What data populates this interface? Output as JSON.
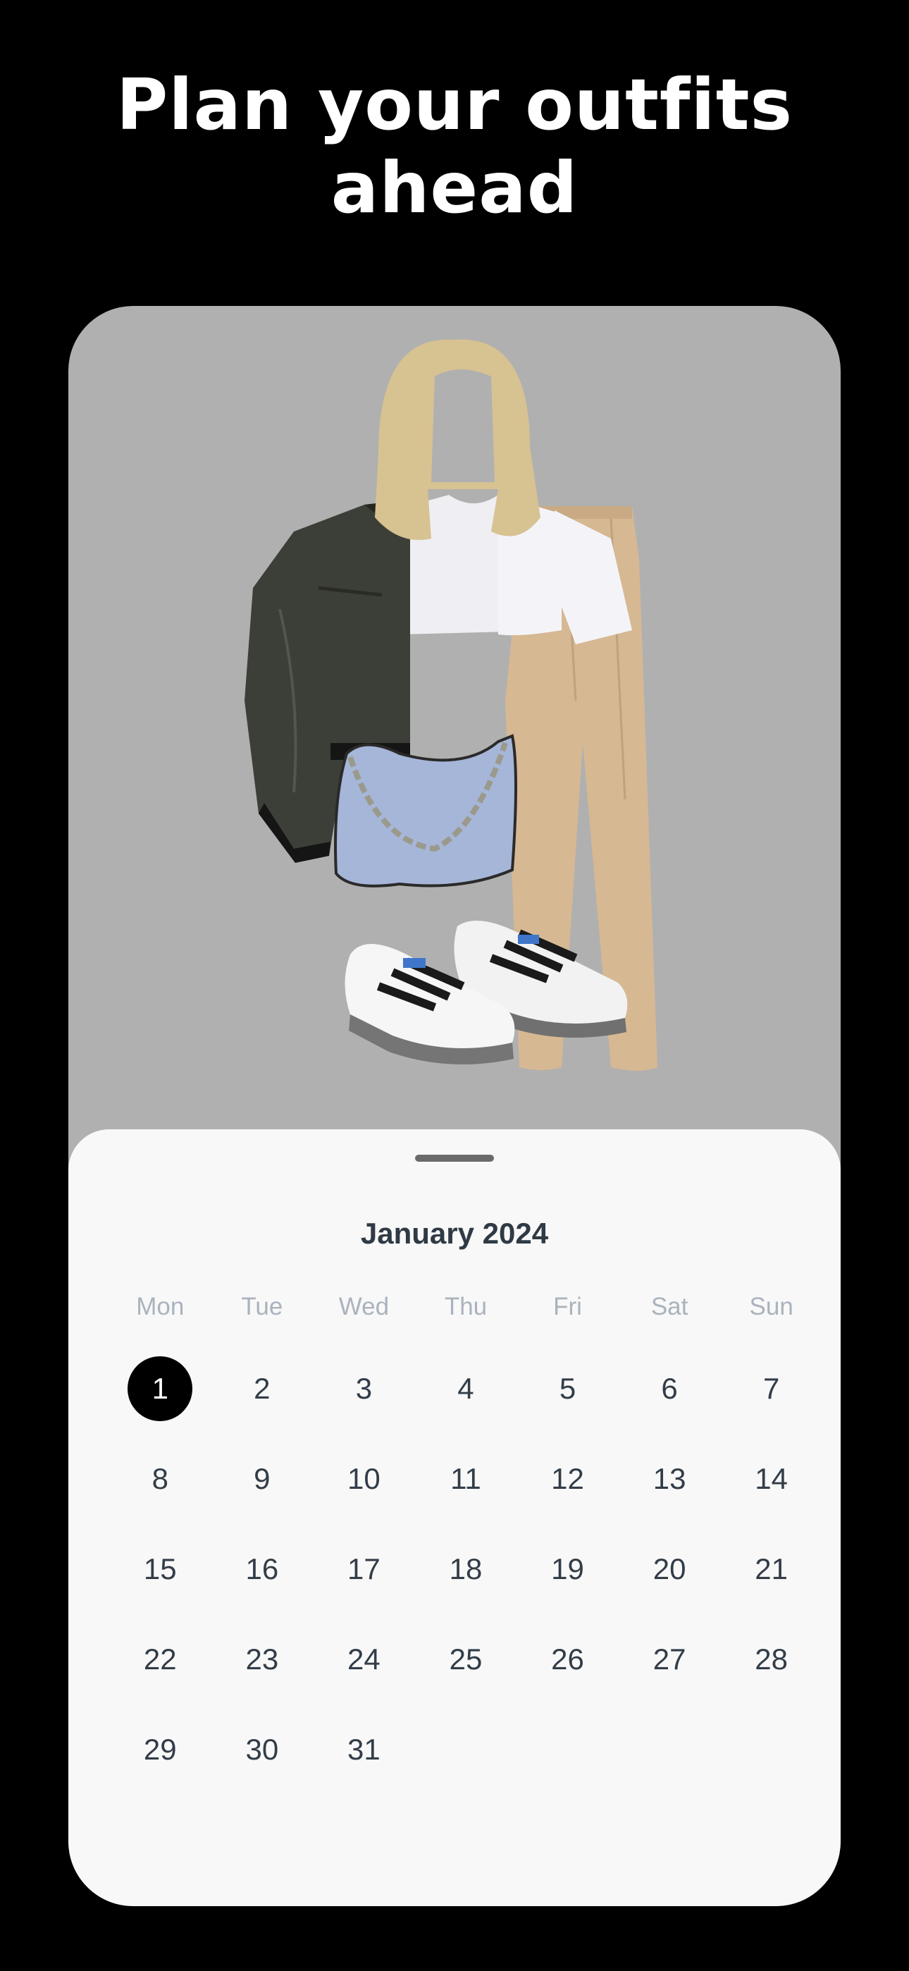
{
  "headline": {
    "line1": "Plan your outfits",
    "line2": "ahead"
  },
  "outfit": {
    "items": [
      "hair",
      "leather-jacket",
      "white-tshirt",
      "beige-trousers",
      "blue-shoulder-bag",
      "sneakers"
    ]
  },
  "calendar": {
    "month_title": "January 2024",
    "weekdays": [
      "Mon",
      "Tue",
      "Wed",
      "Thu",
      "Fri",
      "Sat",
      "Sun"
    ],
    "days": [
      {
        "label": "1",
        "selected": true
      },
      {
        "label": "2"
      },
      {
        "label": "3"
      },
      {
        "label": "4"
      },
      {
        "label": "5"
      },
      {
        "label": "6"
      },
      {
        "label": "7"
      },
      {
        "label": "8"
      },
      {
        "label": "9"
      },
      {
        "label": "10"
      },
      {
        "label": "11"
      },
      {
        "label": "12"
      },
      {
        "label": "13"
      },
      {
        "label": "14"
      },
      {
        "label": "15"
      },
      {
        "label": "16"
      },
      {
        "label": "17"
      },
      {
        "label": "18"
      },
      {
        "label": "19"
      },
      {
        "label": "20"
      },
      {
        "label": "21"
      },
      {
        "label": "22"
      },
      {
        "label": "23"
      },
      {
        "label": "24"
      },
      {
        "label": "25"
      },
      {
        "label": "26"
      },
      {
        "label": "27"
      },
      {
        "label": "28"
      },
      {
        "label": "29"
      },
      {
        "label": "30"
      },
      {
        "label": "31"
      }
    ]
  },
  "colors": {
    "background": "#000000",
    "card": "#b0b0b0",
    "sheet": "#f8f8f8",
    "selected_day": "#000000",
    "day_text": "#333d48",
    "weekday_text": "#aab3bd"
  }
}
